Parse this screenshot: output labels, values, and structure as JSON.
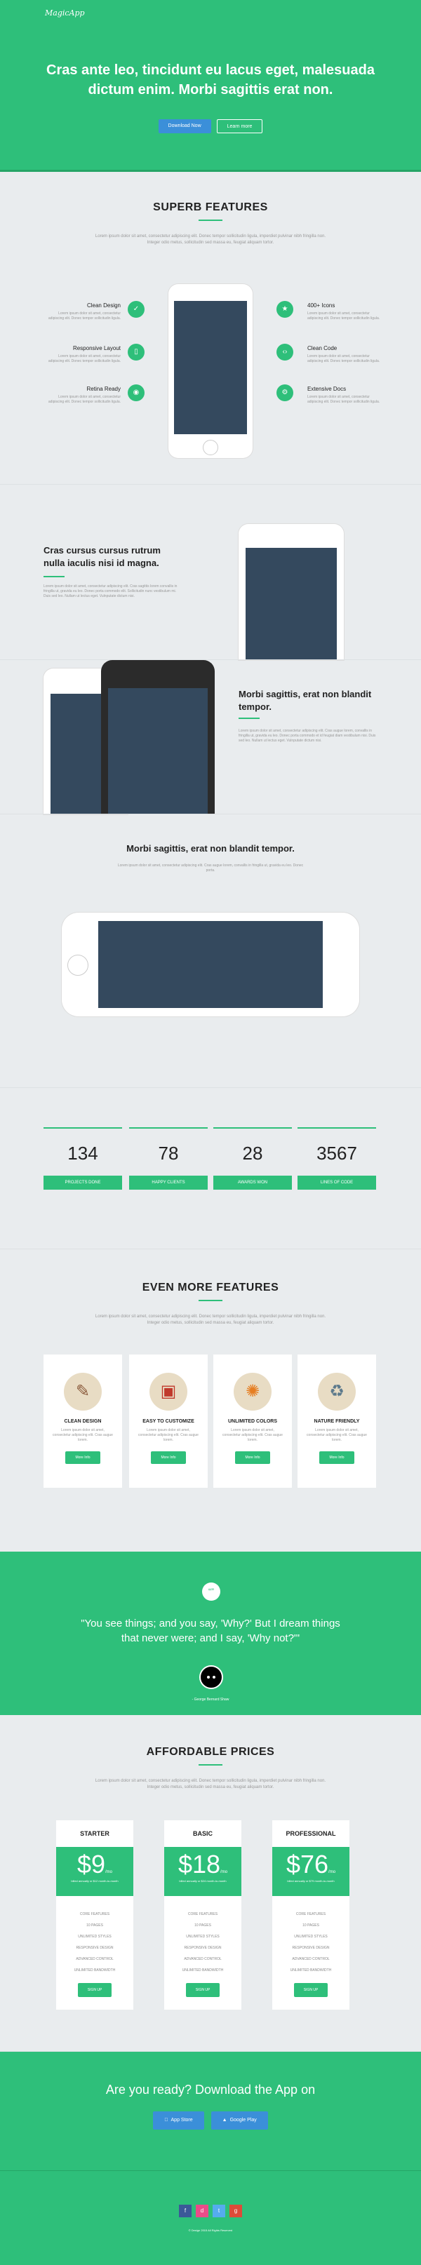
{
  "logo": "MagicApp",
  "hero": {
    "title": "Cras ante leo, tincidunt eu lacus eget, malesuada dictum enim. Morbi sagittis erat non.",
    "download_label": "Download Now",
    "learn_label": "Learn more"
  },
  "features": {
    "title": "SUPERB FEATURES",
    "lead": "Lorem ipsum dolor sit amet, consectetur adipiscing elit. Donec tempor sollicitudin ligula, imperdiet pulvinar nibh fringilla non. Integer odio metus, sollicitudin sed massa eu, feugiat aliquam tortor.",
    "left": [
      {
        "title": "Clean Design",
        "text": "Lorem ipsum dolor sit amet, consectetur adipiscing elit. Donec tempor sollicitudin ligula.",
        "icon": "checkmark-icon"
      },
      {
        "title": "Responsive Layout",
        "text": "Lorem ipsum dolor sit amet, consectetur adipiscing elit. Donec tempor sollicitudin ligula.",
        "icon": "mobile-icon"
      },
      {
        "title": "Retina Ready",
        "text": "Lorem ipsum dolor sit amet, consectetur adipiscing elit. Donec tempor sollicitudin ligula.",
        "icon": "eye-icon"
      }
    ],
    "right": [
      {
        "title": "400+ Icons",
        "text": "Lorem ipsum dolor sit amet, consectetur adipiscing elit. Donec tempor sollicitudin ligula.",
        "icon": "star-icon"
      },
      {
        "title": "Clean Code",
        "text": "Lorem ipsum dolor sit amet, consectetur adipiscing elit. Donec tempor sollicitudin ligula.",
        "icon": "code-icon"
      },
      {
        "title": "Extensive Docs",
        "text": "Lorem ipsum dolor sit amet, consectetur adipiscing elit. Donec tempor sollicitudin ligula.",
        "icon": "gear-icon"
      }
    ]
  },
  "block1": {
    "title": "Cras cursus cursus rutrum nulla iaculis nisi id magna.",
    "text": "Lorem ipsum dolor sit amet, consectetur adipiscing elit. Cras sagittis lorem convallis in fringilla ut, gravida eu leo. Donec porta commodo elit. Sollicitudin nunc vestibulum mi. Duis sed leo. Nullam ut lectus eget. Vulnputate dictum nisi."
  },
  "block2": {
    "title": "Morbi sagittis, erat non blandit tempor.",
    "text": "Lorem ipsum dolor sit amet, consectetur adipiscing elit. Cras augue lorem, convallis in fringilla ut, gravida eu leo. Donec porta commodo et id feugiat diam vestibulum nisi. Duis sed leo. Nullam ut lectus eget. Vulnputate dictum nisi."
  },
  "block3": {
    "title": "Morbi sagittis, erat non blandit tempor.",
    "text": "Lorem ipsum dolor sit amet, consectetur adipiscing elit. Cras augue lorem, convallis in fringilla ut, gravida eu leo. Donec porta."
  },
  "stats": [
    {
      "value": "134",
      "label": "PROJECTS DONE"
    },
    {
      "value": "78",
      "label": "HAPPY CLIENTS"
    },
    {
      "value": "28",
      "label": "AWARDS WON"
    },
    {
      "value": "3567",
      "label": "LINES OF CODE"
    }
  ],
  "more": {
    "title": "EVEN MORE FEATURES",
    "lead": "Lorem ipsum dolor sit amet, consectetur adipiscing elit. Donec tempor sollicitudin ligula, imperdiet pulvinar nibh fringilla non. Integer odio metus, sollicitudin sed massa eu, feugiat aliquam tortor.",
    "cards": [
      {
        "title": "CLEAN DESIGN",
        "text": "Lorem ipsum dolor sit amet, consectetur adipiscing elit. Cras augue lorem.",
        "button": "More Info",
        "icon": "paintbrush-icon"
      },
      {
        "title": "EASY TO CUSTOMIZE",
        "text": "Lorem ipsum dolor sit amet, consectetur adipiscing elit. Cras augue lorem.",
        "button": "More Info",
        "icon": "toolbox-icon"
      },
      {
        "title": "UNLIMITED COLORS",
        "text": "Lorem ipsum dolor sit amet, consectetur adipiscing elit. Cras augue lorem.",
        "button": "More Info",
        "icon": "palette-icon"
      },
      {
        "title": "NATURE FRIENDLY",
        "text": "Lorem ipsum dolor sit amet, consectetur adipiscing elit. Cras augue lorem.",
        "button": "More Info",
        "icon": "recycle-icon"
      }
    ]
  },
  "quote": {
    "mark": "“”",
    "text": "\"You see things; and you say, 'Why?' But I dream things that never were; and I say, 'Why not?'\"",
    "author": "- George Bernard Shaw"
  },
  "prices": {
    "title": "AFFORDABLE PRICES",
    "lead": "Lorem ipsum dolor sit amet, consectetur adipiscing elit. Donec tempor sollicitudin ligula, imperdiet pulvinar nibh fringilla non. Integer odio metus, sollicitudin sed massa eu, feugiat aliquam tortor.",
    "plans": [
      {
        "name": "STARTER",
        "amount": "$9",
        "per": "/mo",
        "note": "billed annually or $12 month-to-month",
        "items": [
          "CORE FEATURES",
          "10 PAGES",
          "UNLIMITED STYLES",
          "RESPONSIVE DESIGN",
          "ADVANCED CONTROL",
          "UNLIMITED BANDWIDTH"
        ],
        "button": "SIGN UP"
      },
      {
        "name": "BASIC",
        "amount": "$18",
        "per": "/mo",
        "note": "billed annually or $24 month-to-month",
        "items": [
          "CORE FEATURES",
          "10 PAGES",
          "UNLIMITED STYLES",
          "RESPONSIVE DESIGN",
          "ADVANCED CONTROL",
          "UNLIMITED BANDWIDTH"
        ],
        "button": "SIGN UP"
      },
      {
        "name": "PROFESSIONAL",
        "amount": "$76",
        "per": "/mo",
        "note": "billed annually or $79 month-to-month",
        "items": [
          "CORE FEATURES",
          "10 PAGES",
          "UNLIMITED STYLES",
          "RESPONSIVE DESIGN",
          "ADVANCED CONTROL",
          "UNLIMITED BANDWIDTH"
        ],
        "button": "SIGN UP"
      }
    ]
  },
  "cta": {
    "title": "Are you ready? Download the App on",
    "appstore": "App Store",
    "googleplay": "Google Play"
  },
  "footer": {
    "social": [
      {
        "glyph": "f",
        "icon": "facebook-icon",
        "color": "#3b5998"
      },
      {
        "glyph": "d",
        "icon": "dribbble-icon",
        "color": "#ea4c89"
      },
      {
        "glyph": "t",
        "icon": "twitter-icon",
        "color": "#55acee"
      },
      {
        "glyph": "g",
        "icon": "google-plus-icon",
        "color": "#dd4b39"
      }
    ],
    "copyright": "© Design 2015 All Rights Reserved"
  },
  "colors": {
    "accent": "#2ebf7a",
    "screen": "#34495e",
    "button_blue": "#3b8fd9",
    "background": "#e9ecee"
  }
}
